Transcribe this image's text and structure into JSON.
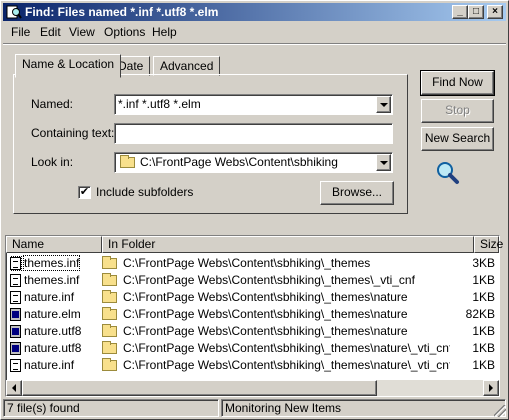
{
  "window": {
    "title": "Find: Files named *.inf *.utf8 *.elm",
    "controls": {
      "minimize": "_",
      "maximize": "□",
      "close": "×"
    }
  },
  "menubar": {
    "items": [
      {
        "label": "File"
      },
      {
        "label": "Edit"
      },
      {
        "label": "View"
      },
      {
        "label": "Options"
      },
      {
        "label": "Help"
      }
    ]
  },
  "tabs": [
    {
      "label": "Name & Location",
      "active": true
    },
    {
      "label": "Date",
      "active": false
    },
    {
      "label": "Advanced",
      "active": false
    }
  ],
  "form": {
    "named_label": "Named:",
    "named_value": "*.inf *.utf8 *.elm",
    "containing_label": "Containing text:",
    "containing_value": "",
    "lookin_label": "Look in:",
    "lookin_value": "C:\\FrontPage Webs\\Content\\sbhiking",
    "include_subfolders_label": "Include subfolders",
    "include_subfolders_checked": true,
    "browse_label": "Browse..."
  },
  "buttons": {
    "find_now": "Find Now",
    "stop": "Stop",
    "new_search": "New Search"
  },
  "results": {
    "columns": [
      "Name",
      "In Folder",
      "Size"
    ],
    "rows": [
      {
        "name": "themes.inf",
        "folder": "C:\\FrontPage Webs\\Content\\sbhiking\\_themes",
        "size": "3KB",
        "icon": "inf-file-icon"
      },
      {
        "name": "themes.inf",
        "folder": "C:\\FrontPage Webs\\Content\\sbhiking\\_themes\\_vti_cnf",
        "size": "1KB",
        "icon": "inf-file-icon"
      },
      {
        "name": "nature.inf",
        "folder": "C:\\FrontPage Webs\\Content\\sbhiking\\_themes\\nature",
        "size": "1KB",
        "icon": "inf-file-icon"
      },
      {
        "name": "nature.elm",
        "folder": "C:\\FrontPage Webs\\Content\\sbhiking\\_themes\\nature",
        "size": "82KB",
        "icon": "elm-file-icon"
      },
      {
        "name": "nature.utf8",
        "folder": "C:\\FrontPage Webs\\Content\\sbhiking\\_themes\\nature",
        "size": "1KB",
        "icon": "utf8-file-icon"
      },
      {
        "name": "nature.utf8",
        "folder": "C:\\FrontPage Webs\\Content\\sbhiking\\_themes\\nature\\_vti_cnf",
        "size": "1KB",
        "icon": "utf8-file-icon"
      },
      {
        "name": "nature.inf",
        "folder": "C:\\FrontPage Webs\\Content\\sbhiking\\_themes\\nature\\_vti_cnf",
        "size": "1KB",
        "icon": "inf-file-icon"
      }
    ]
  },
  "status": {
    "count_text": "7 file(s) found",
    "monitor_text": "Monitoring New Items"
  }
}
